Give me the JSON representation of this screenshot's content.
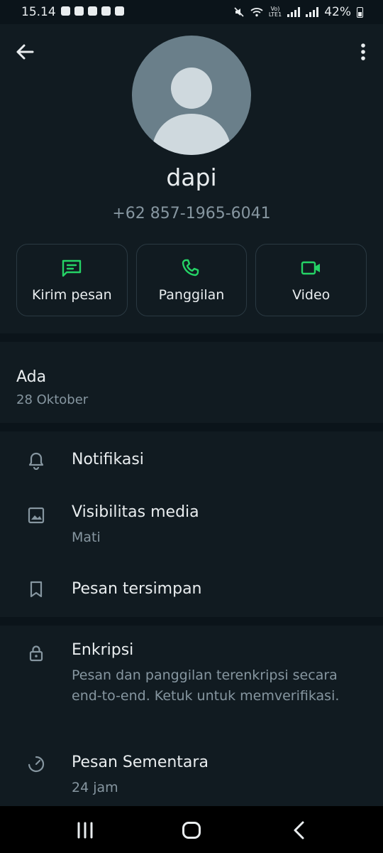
{
  "status_bar": {
    "time": "15.14",
    "battery": "42%",
    "network_label_top": "Vo)",
    "network_label_bottom": "LTE1"
  },
  "contact": {
    "name": "dapi",
    "phone": "+62 857-1965-6041"
  },
  "actions": [
    {
      "label": "Kirim pesan",
      "icon": "message-icon"
    },
    {
      "label": "Panggilan",
      "icon": "phone-icon"
    },
    {
      "label": "Video",
      "icon": "video-icon"
    }
  ],
  "about": {
    "title": "Ada",
    "date": "28 Oktober"
  },
  "settings": {
    "notifications": {
      "title": "Notifikasi",
      "icon": "bell-icon"
    },
    "media_visibility": {
      "title": "Visibilitas media",
      "subtitle": "Mati",
      "icon": "image-icon"
    },
    "saved_messages": {
      "title": "Pesan tersimpan",
      "icon": "bookmark-icon"
    }
  },
  "security": {
    "encryption": {
      "title": "Enkripsi",
      "subtitle": "Pesan dan panggilan terenkripsi secara end-to-end. Ketuk untuk memverifikasi.",
      "icon": "lock-icon"
    },
    "disappearing": {
      "title": "Pesan Sementara",
      "subtitle": "24 jam",
      "icon": "timer-icon"
    }
  },
  "colors": {
    "background": "#111b21",
    "accent": "#25d366",
    "text_primary": "#e9edef",
    "text_secondary": "#8696a0"
  }
}
